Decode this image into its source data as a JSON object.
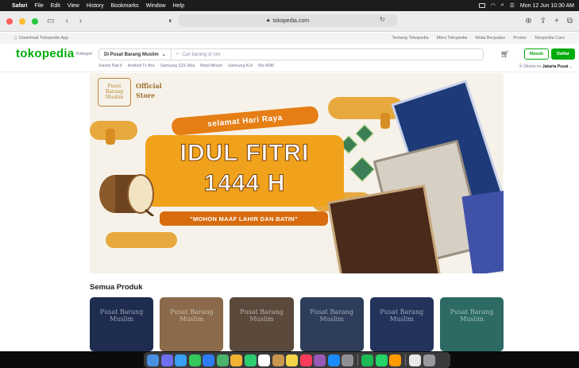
{
  "menubar": {
    "app": "Safari",
    "menus": [
      "File",
      "Edit",
      "View",
      "History",
      "Bookmarks",
      "Window",
      "Help"
    ],
    "datetime": "Mon 12 Jun  10:30 AM"
  },
  "browser": {
    "url": "tokopedia.com"
  },
  "topstrip": {
    "download": "Download Tokopedia App",
    "links": [
      "Tentang Tokopedia",
      "Mitra Tokopedia",
      "Mulai Berjualan",
      "Promo",
      "Tokopedia Care"
    ]
  },
  "header": {
    "logo": "tokopedia",
    "kategori": "Kategori",
    "store_selector": "Di Pusat Barang Muslim",
    "search_placeholder": "Cari barang di sini",
    "login": "Masuk",
    "register": "Daftar",
    "quick_links": [
      "Xiaomi Pad 6",
      "Android Tv Box",
      "Samsung S23 Ultra",
      "Botol Minum",
      "Samsung A14",
      "Rtx 4090"
    ],
    "location_prefix": "Dikirim ke",
    "location": "Jakarta Pusat"
  },
  "banner": {
    "store_logo_lines": [
      "Pusat",
      "Barang",
      "Muslim"
    ],
    "official_lines": [
      "Official",
      "Store"
    ],
    "greeting": "selamat Hari Raya",
    "title_line1": "IDUL FITRI",
    "title_line2": "1444 H",
    "subtitle": "\"MOHON MAAF LAHIR DAN BATIN\""
  },
  "section_title": "Semua Produk",
  "products": [
    {
      "label": "Pusat Barang Muslim",
      "bg": "#1d2c4f"
    },
    {
      "label": "Pusat Barang Muslim",
      "bg": "#8a6a4a"
    },
    {
      "label": "Pusat Barang Muslim",
      "bg": "#5b4a3c"
    },
    {
      "label": "Pusat Barang Muslim",
      "bg": "#2d3d5a"
    },
    {
      "label": "Pusat Barang Muslim",
      "bg": "#23335c"
    },
    {
      "label": "Pusat Barang Muslim",
      "bg": "#2c6a63"
    }
  ],
  "colors": {
    "brand": "#03ac0e",
    "accent": "#f0a21c"
  }
}
